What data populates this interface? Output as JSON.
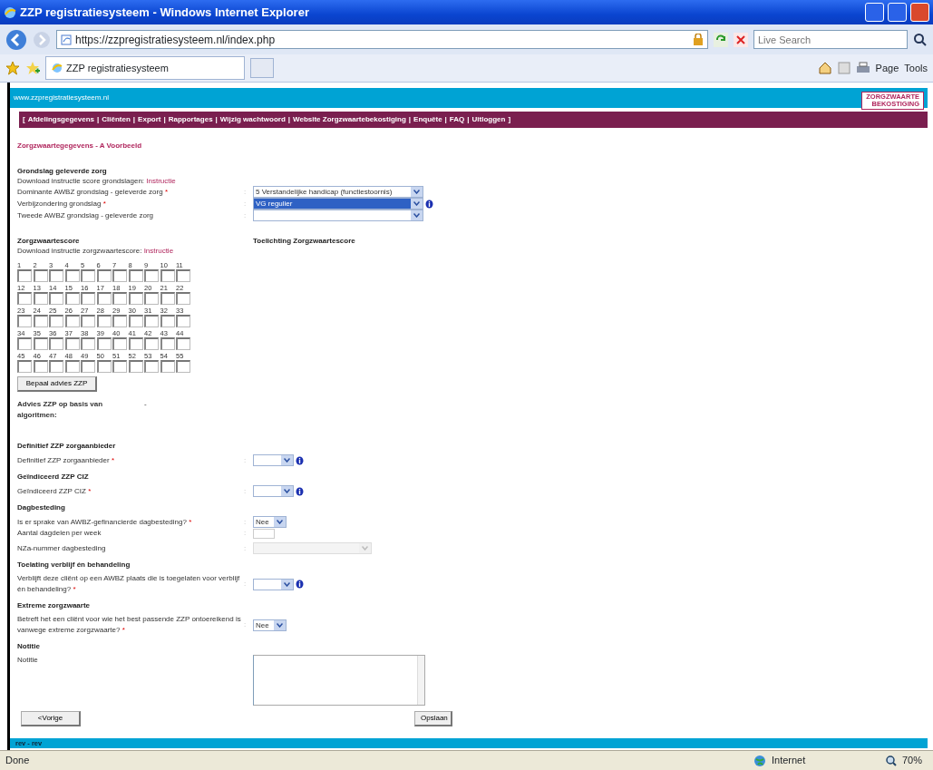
{
  "window": {
    "title": "ZZP registratiesysteem - Windows Internet Explorer"
  },
  "address_bar": {
    "url": "https://zzpregistratiesysteem.nl/index.php",
    "search_placeholder": "Live Search"
  },
  "tab": {
    "label": "ZZP registratiesysteem"
  },
  "toolbar": [
    "Page",
    "Tools"
  ],
  "site": {
    "url": "www.zzpregistratiesysteem.nl",
    "logo": [
      "ZORGZWAARTE",
      "BEKOSTIGING"
    ]
  },
  "menu": {
    "open": "[",
    "close": "]",
    "separator": "|",
    "items": [
      "Afdelingsgegevens",
      "Cliënten",
      "Export",
      "Rapportages",
      "Wijzig wachtwoord",
      "Website Zorgzwaartebekostiging",
      "Enquête",
      "FAQ",
      "Uitloggen"
    ]
  },
  "page_title": "Zorgzwaartegegevens - A Voorbeeld",
  "form": [
    {
      "kind": "heading",
      "text": "Grondslag geleverde zorg"
    },
    {
      "kind": "note",
      "text": "Download instructie score grondslagen: ",
      "link": "Instructie"
    },
    {
      "kind": "wide-select",
      "label": "Dominante AWBZ grondslag - geleverde zorg",
      "required": "*",
      "separator": ":",
      "value": "5 Verstandelijke handicap (functiestoornis)",
      "selected": false,
      "info": false
    },
    {
      "kind": "wide-select",
      "label": "Verbijzondering grondslag",
      "required": "*",
      "separator": ":",
      "value": "VG regulier",
      "selected": true,
      "info": true
    },
    {
      "kind": "wide-select",
      "label": "Tweede AWBZ grondslag - geleverde zorg",
      "separator": ":",
      "selected": false,
      "info": false
    }
  ],
  "score": {
    "heading": "Zorgzwaartescore",
    "note": "Download instructie zorgzwaartescore: ",
    "link": "Instructie",
    "side_heading": "Toelichting Zorgzwaartescore",
    "numbers": [
      "1",
      "2",
      "3",
      "4",
      "5",
      "6",
      "7",
      "8",
      "9",
      "10",
      "11",
      "12",
      "13",
      "14",
      "15",
      "16",
      "17",
      "18",
      "19",
      "20",
      "21",
      "22",
      "23",
      "24",
      "25",
      "26",
      "27",
      "28",
      "29",
      "30",
      "31",
      "32",
      "33",
      "34",
      "35",
      "36",
      "37",
      "38",
      "39",
      "40",
      "41",
      "42",
      "43",
      "44",
      "45",
      "46",
      "47",
      "48",
      "49",
      "50",
      "51",
      "52",
      "53",
      "54",
      "55"
    ],
    "button": "Bepaal advies ZZP",
    "advice_label": "Advies ZZP op basis van algoritmen:",
    "advice_value": "-"
  },
  "form2": [
    {
      "kind": "heading",
      "text": "Definitief ZZP zorgaanbieder"
    },
    {
      "kind": "select",
      "label": "Definitief ZZP zorgaanbieder",
      "required": "*",
      "separator": ":",
      "info": true,
      "disabled": false
    },
    {
      "kind": "heading",
      "text": "Geïndiceerd ZZP CIZ"
    },
    {
      "kind": "select",
      "label": "Geïndiceerd ZZP CIZ",
      "required": "*",
      "separator": ":",
      "info": true,
      "disabled": false
    },
    {
      "kind": "heading",
      "text": "Dagbesteding"
    },
    {
      "kind": "select",
      "label": "Is er sprake van AWBZ-gefinancierde dagbesteding?",
      "required": "*",
      "separator": ":",
      "value": "Nee",
      "info": false,
      "disabled": false
    },
    {
      "kind": "input",
      "label": "Aantal dagdelen per week",
      "separator": ":"
    },
    {
      "kind": "select",
      "label": "NZa-nummer dagbesteding",
      "separator": ":",
      "info": false,
      "disabled": true
    },
    {
      "kind": "heading",
      "text": "Toelating verblijf én behandeling"
    },
    {
      "kind": "select",
      "label": "Verblijft deze cliënt op een AWBZ plaats die is toegelaten voor verblijf én behandeling?",
      "required": "*",
      "separator": ":",
      "info": true,
      "disabled": false
    },
    {
      "kind": "heading",
      "text": "Extreme zorgzwaarte"
    },
    {
      "kind": "select",
      "label": "Betreft het een cliënt voor wie het best passende ZZP ontoereikend is vanwege extreme zorgzwaarte?",
      "required": "*",
      "separator": ":",
      "value": "Nee",
      "info": false,
      "disabled": false
    },
    {
      "kind": "heading",
      "text": "Notitie"
    },
    {
      "kind": "textarea",
      "label": "Notitie"
    }
  ],
  "buttons": [
    "<Vorige",
    "Opslaan"
  ],
  "footer": "rev - rev",
  "status_bar": {
    "text": "Done",
    "zone": "Internet",
    "zoom": "70%"
  }
}
